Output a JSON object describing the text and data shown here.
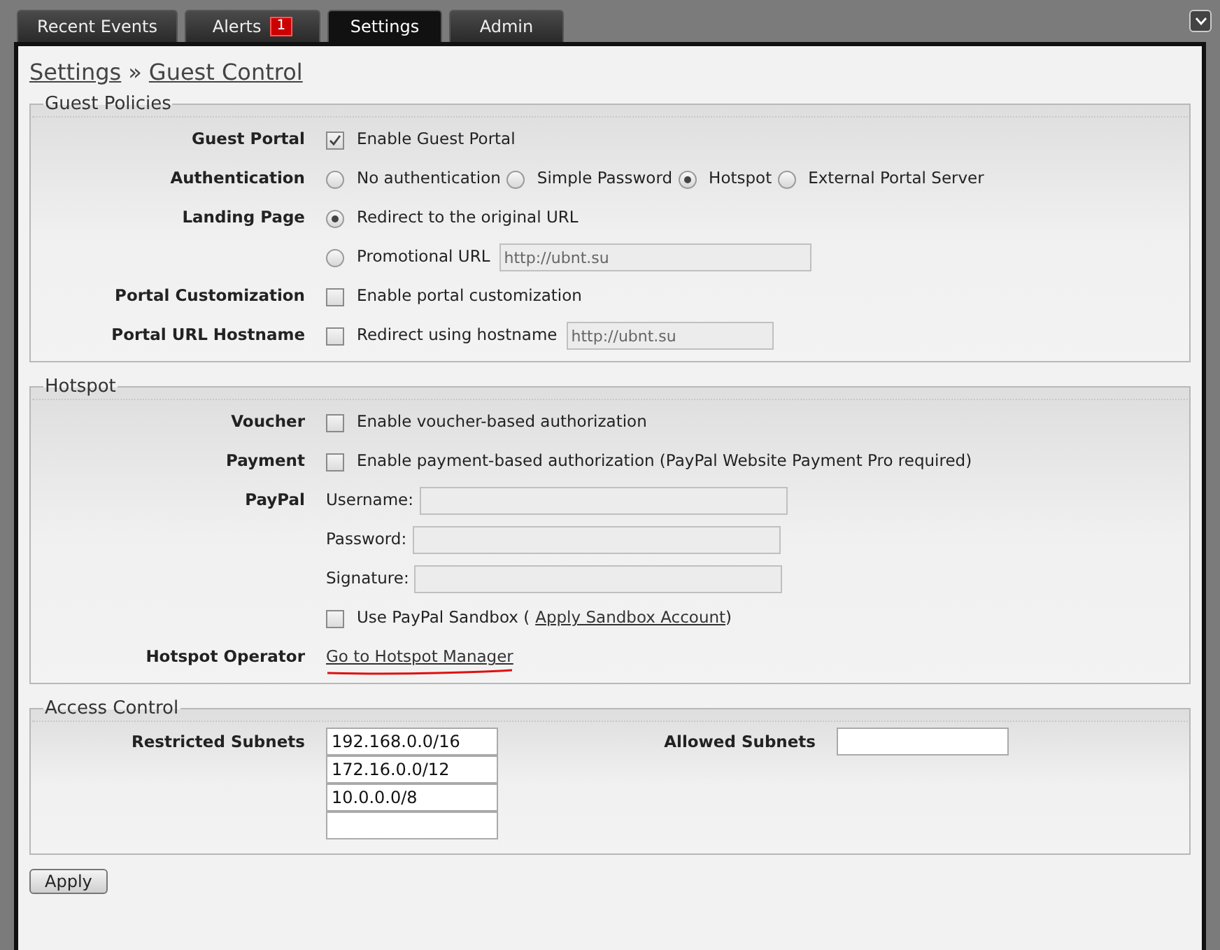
{
  "tabs": [
    {
      "label": "Recent Events",
      "selected": false
    },
    {
      "label": "Alerts",
      "selected": false,
      "badge": "1"
    },
    {
      "label": "Settings",
      "selected": true
    },
    {
      "label": "Admin",
      "selected": false
    }
  ],
  "breadcrumb": {
    "parent": "Settings",
    "separator": "»",
    "current": "Guest Control"
  },
  "sections": [
    {
      "title": "Guest Policies",
      "rows": [
        {
          "label": "Guest Portal",
          "items": [
            {
              "kind": "checkbox",
              "text": "Enable Guest Portal",
              "checked": true
            }
          ]
        },
        {
          "label": "Authentication",
          "items": [
            {
              "kind": "radio",
              "text": "No authentication",
              "selected": false
            },
            {
              "kind": "radio",
              "text": "Simple Password",
              "selected": false
            },
            {
              "kind": "radio",
              "text": "Hotspot",
              "selected": true
            },
            {
              "kind": "radio",
              "text": "External Portal Server",
              "selected": false
            }
          ]
        },
        {
          "label": "Landing Page",
          "items": [
            {
              "kind": "radio",
              "text": "Redirect to the original URL",
              "selected": true
            }
          ]
        },
        {
          "items": [
            {
              "kind": "radio",
              "text": "Promotional URL",
              "selected": false
            },
            {
              "kind": "field",
              "value": "http://ubnt.su",
              "disabled": true
            }
          ]
        },
        {
          "label": "Portal Customization",
          "items": [
            {
              "kind": "checkbox",
              "text": "Enable portal customization",
              "checked": false
            }
          ]
        },
        {
          "label": "Portal URL Hostname",
          "items": [
            {
              "kind": "checkbox",
              "text": "Redirect using hostname",
              "checked": false
            },
            {
              "kind": "field",
              "value": "http://ubnt.su",
              "disabled": true
            }
          ]
        }
      ]
    },
    {
      "title": "Hotspot",
      "rows": [
        {
          "label": "Voucher",
          "items": [
            {
              "kind": "checkbox",
              "text": "Enable voucher-based authorization",
              "checked": false
            }
          ]
        },
        {
          "label": "Payment",
          "items": [
            {
              "kind": "checkbox",
              "text": "Enable payment-based authorization (PayPal Website Payment Pro required)",
              "checked": false
            }
          ]
        },
        {
          "label": "PayPal",
          "items": [
            {
              "kind": "text",
              "text": "Username:"
            },
            {
              "kind": "field",
              "disabled": true
            }
          ]
        },
        {
          "items": [
            {
              "kind": "text",
              "text": "Password:"
            },
            {
              "kind": "field",
              "disabled": true
            }
          ]
        },
        {
          "items": [
            {
              "kind": "text",
              "text": "Signature:"
            },
            {
              "kind": "field",
              "disabled": true
            }
          ]
        },
        {
          "items": [
            {
              "kind": "checkbox",
              "text": "Use PayPal Sandbox (",
              "checked": false
            },
            {
              "kind": "link",
              "text": "Apply Sandbox Account"
            },
            {
              "kind": "text",
              "text": ")"
            }
          ]
        },
        {
          "label": "Hotspot Operator",
          "items": [
            {
              "kind": "link",
              "text": "Go to Hotspot Manager",
              "annotated": true
            }
          ]
        }
      ]
    }
  ],
  "access_control": {
    "title": "Access Control",
    "restricted": {
      "label": "Restricted Subnets",
      "fields": [
        "192.168.0.0/16",
        "172.16.0.0/12",
        "10.0.0.0/8"
      ]
    },
    "allowed": {
      "label": "Allowed Subnets"
    }
  },
  "apply_button": "Apply"
}
